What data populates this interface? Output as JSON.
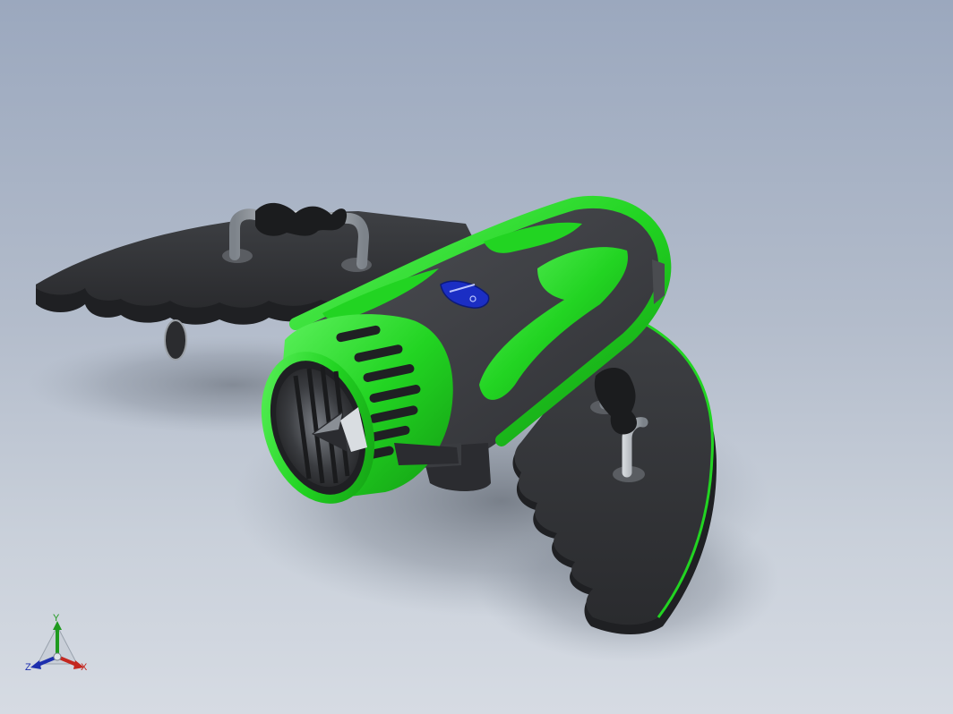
{
  "viewport": {
    "background_top": "#9ba8be",
    "background_bottom": "#d6dbe3"
  },
  "model": {
    "colors": {
      "body_dark": "#3a3c40",
      "body_green": "#22d422",
      "green_highlight": "#6cf36c",
      "logo_blue": "#1b2ec4",
      "metal": "#a7adb4"
    }
  },
  "triad": {
    "x_label": "X",
    "y_label": "Y",
    "z_label": "Z",
    "x_color": "#c4271f",
    "y_color": "#1f9a1f",
    "z_color": "#1d2fae"
  }
}
